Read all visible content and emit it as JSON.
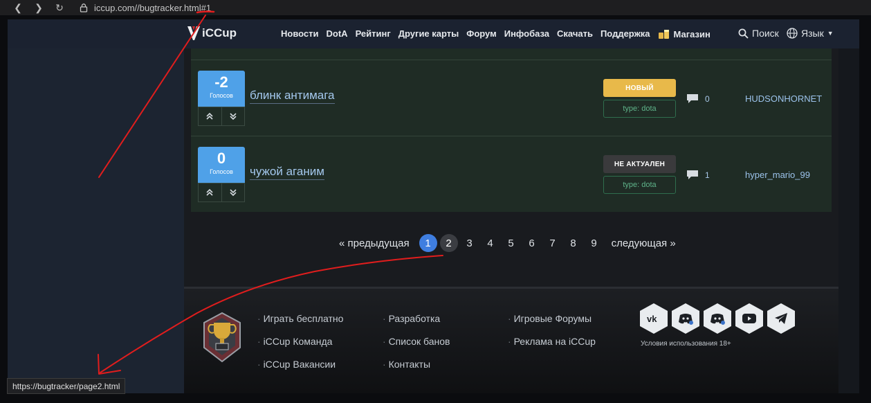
{
  "browser": {
    "url": "iccup.com//bugtracker.html#1",
    "status_url": "https://bugtracker/page2.html"
  },
  "nav": {
    "logo": "iCCup",
    "items": [
      "Новости",
      "DotA",
      "Рейтинг",
      "Другие карты",
      "Форум",
      "Инфобаза",
      "Скачать",
      "Поддержка"
    ],
    "shop": "Магазин",
    "search": "Поиск",
    "language": "Язык"
  },
  "bugs": [
    {
      "votes": "-2",
      "votes_label": "Голосов",
      "title": "блинк антимага",
      "status": "НОВЫЙ",
      "type": "type: dota",
      "comments": "0",
      "author": "HUDSONHORNET"
    },
    {
      "votes": "0",
      "votes_label": "Голосов",
      "title": "чужой аганим",
      "status": "НЕ АКТУАЛЕН",
      "type": "type: dota",
      "comments": "1",
      "author": "hyper_mario_99"
    }
  ],
  "pagination": {
    "prev": "« предыдущая",
    "pages": [
      "1",
      "2",
      "3",
      "4",
      "5",
      "6",
      "7",
      "8",
      "9"
    ],
    "current": "1",
    "next": "следующая »"
  },
  "footer": {
    "col1": [
      "Играть бесплатно",
      "iCCup Команда",
      "iCCup Вакансии"
    ],
    "col2": [
      "Разработка",
      "Список банов",
      "Контакты"
    ],
    "col3": [
      "Игровые Форумы",
      "Реклама на iCCup"
    ],
    "social": [
      "vk-icon",
      "discord-home-icon",
      "discord-settings-icon",
      "youtube-icon",
      "telegram-icon"
    ],
    "terms": "Условия использования 18+"
  },
  "colors": {
    "accent": "#3f7ee0",
    "vote": "#4fa1e8",
    "status_new": "#e8b94a",
    "annotation": "#e11d1d"
  }
}
